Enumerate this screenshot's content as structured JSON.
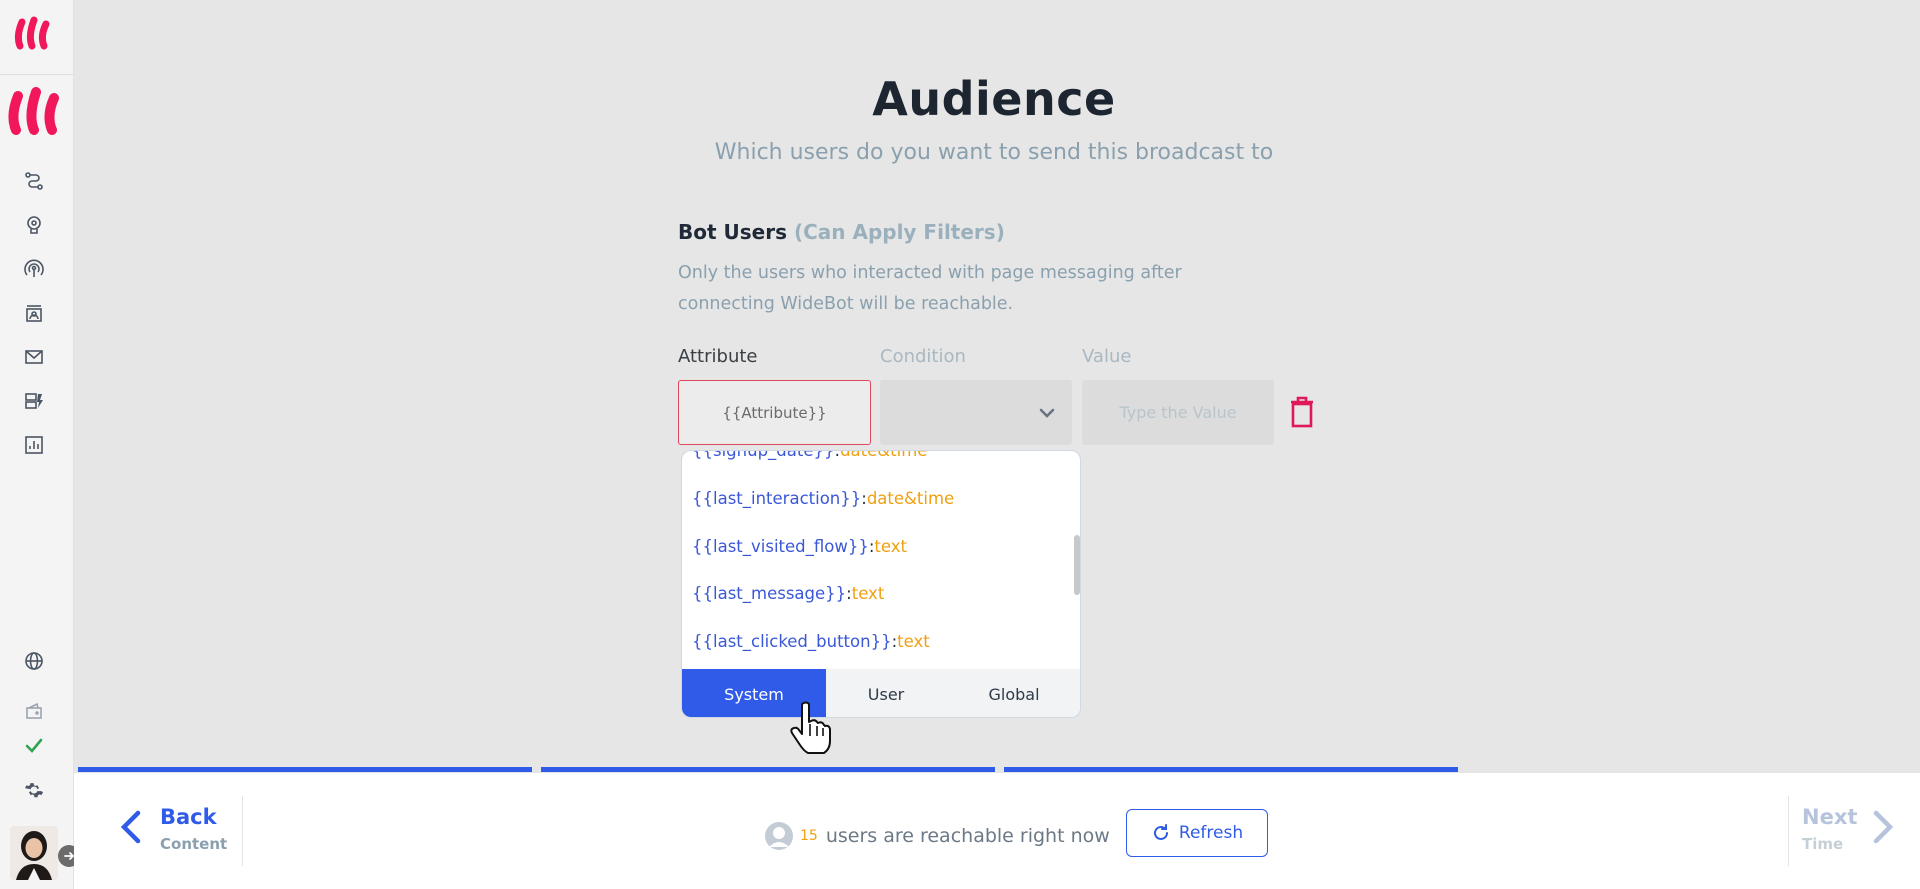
{
  "header": {
    "title": "Audience",
    "subtitle": "Which users do you want to send this broadcast to"
  },
  "bot_users": {
    "title": "Bot Users",
    "hint": "(Can Apply Filters)",
    "description": "Only the users who interacted with page messaging after connecting WideBot will be reachable."
  },
  "filter": {
    "attribute_label": "Attribute",
    "condition_label": "Condition",
    "value_label": "Value",
    "attribute_value": "{{Attribute}}",
    "value_placeholder": "Type the Value"
  },
  "dropdown": {
    "items": [
      {
        "var": "{{signup_date}}",
        "type": "date&time"
      },
      {
        "var": "{{last_interaction}}",
        "type": "date&time"
      },
      {
        "var": "{{last_visited_flow}}",
        "type": "text"
      },
      {
        "var": "{{last_message}}",
        "type": "text"
      },
      {
        "var": "{{last_clicked_button}}",
        "type": "text"
      }
    ],
    "tabs": [
      "System",
      "User",
      "Global"
    ],
    "active_tab": "System"
  },
  "progress": {
    "completed_steps": 3,
    "total_steps": 4
  },
  "footer": {
    "back_label": "Back",
    "back_sub": "Content",
    "reach_count": "15",
    "reach_text": "users are reachable right now",
    "refresh_label": "Refresh",
    "next_label": "Next",
    "next_sub": "Time"
  },
  "colors": {
    "accent": "#2f5be8",
    "brand": "#f0185a",
    "error": "#e0485f",
    "type_text": "#f0a010",
    "success": "#2ea44f"
  },
  "icons": {
    "sidebar": [
      "flow-icon",
      "brain-icon",
      "broadcast-icon",
      "contacts-icon",
      "mail-icon",
      "templates-icon",
      "analytics-icon",
      "globe-icon",
      "wallet-icon",
      "check-icon",
      "gear-icon"
    ]
  }
}
